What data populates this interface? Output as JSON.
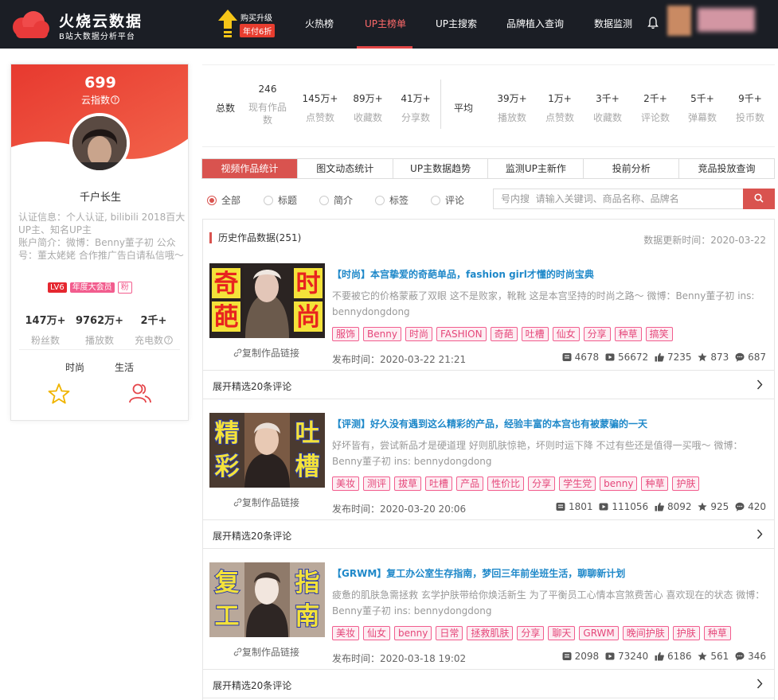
{
  "brand": {
    "title": "火烧云数据",
    "subtitle": "B站大数据分析平台"
  },
  "promo": {
    "line1": "购买升级",
    "line2": "年付6折"
  },
  "nav": {
    "items": [
      "火热榜",
      "UP主榜单",
      "UP主搜索",
      "品牌植入查询",
      "数据监测"
    ],
    "active": "UP主榜单"
  },
  "profile": {
    "cloud_index": "699",
    "cloud_index_label": "云指数",
    "name": "千户长生",
    "cert": "认证信息：个人认证, bilibili 2018百大UP主、知名UP主",
    "bio": "账户简介：微博：Benny董子初 公众号：董太姥姥 合作推广告白请私信哦～",
    "badges": [
      "LV6",
      "年度大会员",
      "粉"
    ],
    "stats": [
      {
        "value": "147万+",
        "label": "粉丝数"
      },
      {
        "value": "9762万+",
        "label": "播放数"
      },
      {
        "value": "2千+",
        "label": "充电数"
      }
    ],
    "tags": [
      "时尚",
      "生活"
    ]
  },
  "summary": {
    "total_label": "总数",
    "total": [
      {
        "value": "246",
        "label": "现有作品数"
      },
      {
        "value": "145万+",
        "label": "点赞数"
      },
      {
        "value": "89万+",
        "label": "收藏数"
      },
      {
        "value": "41万+",
        "label": "分享数"
      }
    ],
    "avg_label": "平均",
    "avg": [
      {
        "value": "39万+",
        "label": "播放数"
      },
      {
        "value": "1万+",
        "label": "点赞数"
      },
      {
        "value": "3千+",
        "label": "收藏数"
      },
      {
        "value": "2千+",
        "label": "评论数"
      },
      {
        "value": "5千+",
        "label": "弹幕数"
      },
      {
        "value": "9千+",
        "label": "投币数"
      }
    ]
  },
  "tabs": [
    "视频作品统计",
    "图文动态统计",
    "UP主数据趋势",
    "监测UP主新作",
    "投前分析",
    "竞品投放查询"
  ],
  "filters": {
    "options": [
      "全部",
      "标题",
      "简介",
      "标签",
      "评论"
    ],
    "selected": "全部"
  },
  "search": {
    "placeholder": "号内搜  请输入关键词、商品名称、品牌名"
  },
  "list": {
    "title": "历史作品数据(251)",
    "updated": "数据更新时间：2020-03-22",
    "copy_label": "复制作品链接",
    "expand_label": "展开精选20条评论",
    "videos": [
      {
        "title": "【时尚】本宫挚爱的奇葩单品，fashion girl才懂的时尚宝典",
        "desc": "不要被它的价格蒙蔽了双眼 这不是败家，靴靴 这是本宫坚持的时尚之路～ 微博：Benny董子初 ins: bennydongdong",
        "tags": [
          "服饰",
          "Benny",
          "时尚",
          "FASHION",
          "奇葩",
          "吐槽",
          "仙女",
          "分享",
          "种草",
          "搞笑"
        ],
        "time": "发布时间：2020-03-22 21:21",
        "metrics": [
          "4678",
          "56672",
          "7235",
          "873",
          "687"
        ],
        "thumb_text": [
          "奇",
          "葩",
          "时",
          "尚"
        ]
      },
      {
        "title": "【评测】好久没有遇到这么精彩的产品，经验丰富的本宫也有被蒙骗的一天",
        "desc": "好坏皆有，尝试新品才是硬道理 好则肌肤惊艳，坏则时运下降 不过有些还是值得一买哦～ 微博：Benny董子初 ins: bennydongdong",
        "tags": [
          "美妆",
          "测评",
          "拔草",
          "吐槽",
          "产品",
          "性价比",
          "分享",
          "学生党",
          "benny",
          "种草",
          "护肤"
        ],
        "time": "发布时间：2020-03-20 20:06",
        "metrics": [
          "1801",
          "111056",
          "8092",
          "925",
          "420"
        ],
        "thumb_text": [
          "精",
          "彩",
          "吐",
          "槽"
        ]
      },
      {
        "title": "【GRWM】复工办公室生存指南，梦回三年前坐班生活，聊聊新计划",
        "desc": "疲惫的肌肤急需拯救 玄学护肤带给你焕活新生 为了平衡员工心情本宫煞费苦心 喜欢现在的状态 微博：Benny董子初 ins: bennydongdong",
        "tags": [
          "美妆",
          "仙女",
          "benny",
          "日常",
          "拯救肌肤",
          "分享",
          "聊天",
          "GRWM",
          "晚间护肤",
          "护肤",
          "种草"
        ],
        "time": "发布时间：2020-03-18 19:02",
        "metrics": [
          "2098",
          "73240",
          "6186",
          "561",
          "346"
        ],
        "thumb_text": [
          "复",
          "工",
          "指",
          "南"
        ]
      }
    ]
  }
}
